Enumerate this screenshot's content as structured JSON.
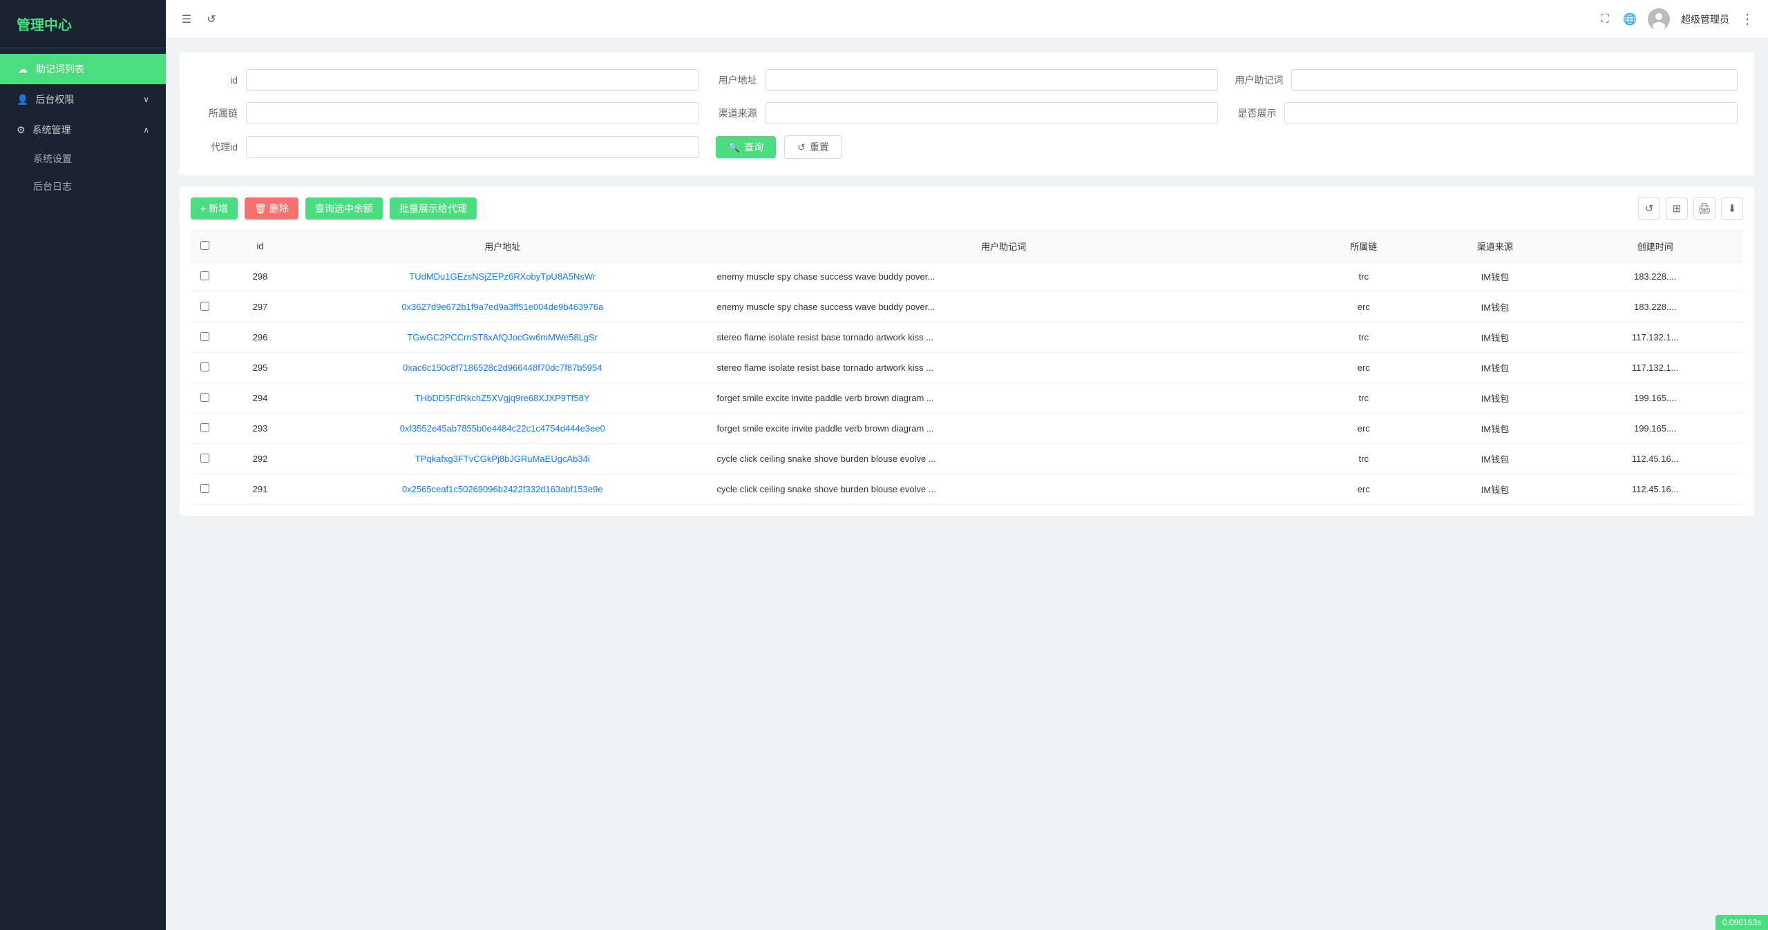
{
  "sidebar": {
    "logo": "管理中心",
    "items": [
      {
        "id": "mnemonic-list",
        "label": "助记词列表",
        "icon": "☁",
        "active": true
      },
      {
        "id": "backend-permissions",
        "label": "后台权限",
        "icon": "👤",
        "expandable": true,
        "expanded": false
      },
      {
        "id": "system-management",
        "label": "系统管理",
        "icon": "⚙",
        "expandable": true,
        "expanded": true
      }
    ],
    "sub_items": [
      {
        "id": "system-settings",
        "label": "系统设置",
        "parent": "system-management"
      },
      {
        "id": "backend-log",
        "label": "后台日志",
        "parent": "system-management"
      }
    ]
  },
  "topbar": {
    "menu_icon": "☰",
    "refresh_icon": "↺",
    "fullscreen_icon": "⛶",
    "globe_icon": "🌐",
    "more_icon": "⋮",
    "admin_name": "超级管理员"
  },
  "filter": {
    "fields": [
      {
        "id": "id",
        "label": "id",
        "placeholder": ""
      },
      {
        "id": "user-address",
        "label": "用户地址",
        "placeholder": ""
      },
      {
        "id": "user-mnemonic",
        "label": "用户助记词",
        "placeholder": ""
      },
      {
        "id": "chain",
        "label": "所属链",
        "placeholder": ""
      },
      {
        "id": "channel",
        "label": "渠道来源",
        "placeholder": ""
      },
      {
        "id": "show-status",
        "label": "是否展示",
        "placeholder": ""
      },
      {
        "id": "agent-id",
        "label": "代理id",
        "placeholder": ""
      }
    ],
    "search_btn": "查询",
    "reset_btn": "重置"
  },
  "toolbar": {
    "add_btn": "+ 新增",
    "delete_btn": "删除",
    "query_balance_btn": "查询选中余额",
    "batch_show_btn": "批量展示给代理"
  },
  "table": {
    "columns": [
      "id",
      "用户地址",
      "用户助记词",
      "所属链",
      "渠道来源",
      "创建时间"
    ],
    "rows": [
      {
        "id": "298",
        "address": "TUdMDu1GEzsNSjZEPz6RXobyTpU8A5NsWr",
        "mnemonic": "enemy muscle spy chase success wave buddy pover...",
        "chain": "trc",
        "channel": "IM钱包",
        "created_at": "183.228...."
      },
      {
        "id": "297",
        "address": "0x3627d9e672b1f9a7ed9a3ff51e004de9b463976a",
        "mnemonic": "enemy muscle spy chase success wave buddy pover...",
        "chain": "erc",
        "channel": "IM钱包",
        "created_at": "183.228...."
      },
      {
        "id": "296",
        "address": "TGwGC2PCCrnST8xAfQJocGw6mMWe58LgSr",
        "mnemonic": "stereo flame isolate resist base tornado artwork kiss ...",
        "chain": "trc",
        "channel": "IM钱包",
        "created_at": "117.132.1..."
      },
      {
        "id": "295",
        "address": "0xac6c150c8f7186528c2d966448f70dc7f87b5954",
        "mnemonic": "stereo flame isolate resist base tornado artwork kiss ...",
        "chain": "erc",
        "channel": "IM钱包",
        "created_at": "117.132.1..."
      },
      {
        "id": "294",
        "address": "THbDD5FdRkchZ5XVgjq9re68XJXP9Tf58Y",
        "mnemonic": "forget smile excite invite paddle verb brown diagram ...",
        "chain": "trc",
        "channel": "IM钱包",
        "created_at": "199.165...."
      },
      {
        "id": "293",
        "address": "0xf3552e45ab7855b0e4484c22c1c4754d444e3ee0",
        "mnemonic": "forget smile excite invite paddle verb brown diagram ...",
        "chain": "erc",
        "channel": "IM钱包",
        "created_at": "199.165...."
      },
      {
        "id": "292",
        "address": "TPqkafxg3FTvCGkPj8bJGRuMaEUgcAb34i",
        "mnemonic": "cycle click ceiling snake shove burden blouse evolve ...",
        "chain": "trc",
        "channel": "IM钱包",
        "created_at": "112.45.16..."
      },
      {
        "id": "291",
        "address": "0x2565ceaf1c50269096b2422f332d163abf153e9e",
        "mnemonic": "cycle click ceiling snake shove burden blouse evolve ...",
        "chain": "erc",
        "channel": "IM钱包",
        "created_at": "112.45.16..."
      }
    ]
  },
  "bottom_badge": {
    "value": "0.096163s"
  }
}
